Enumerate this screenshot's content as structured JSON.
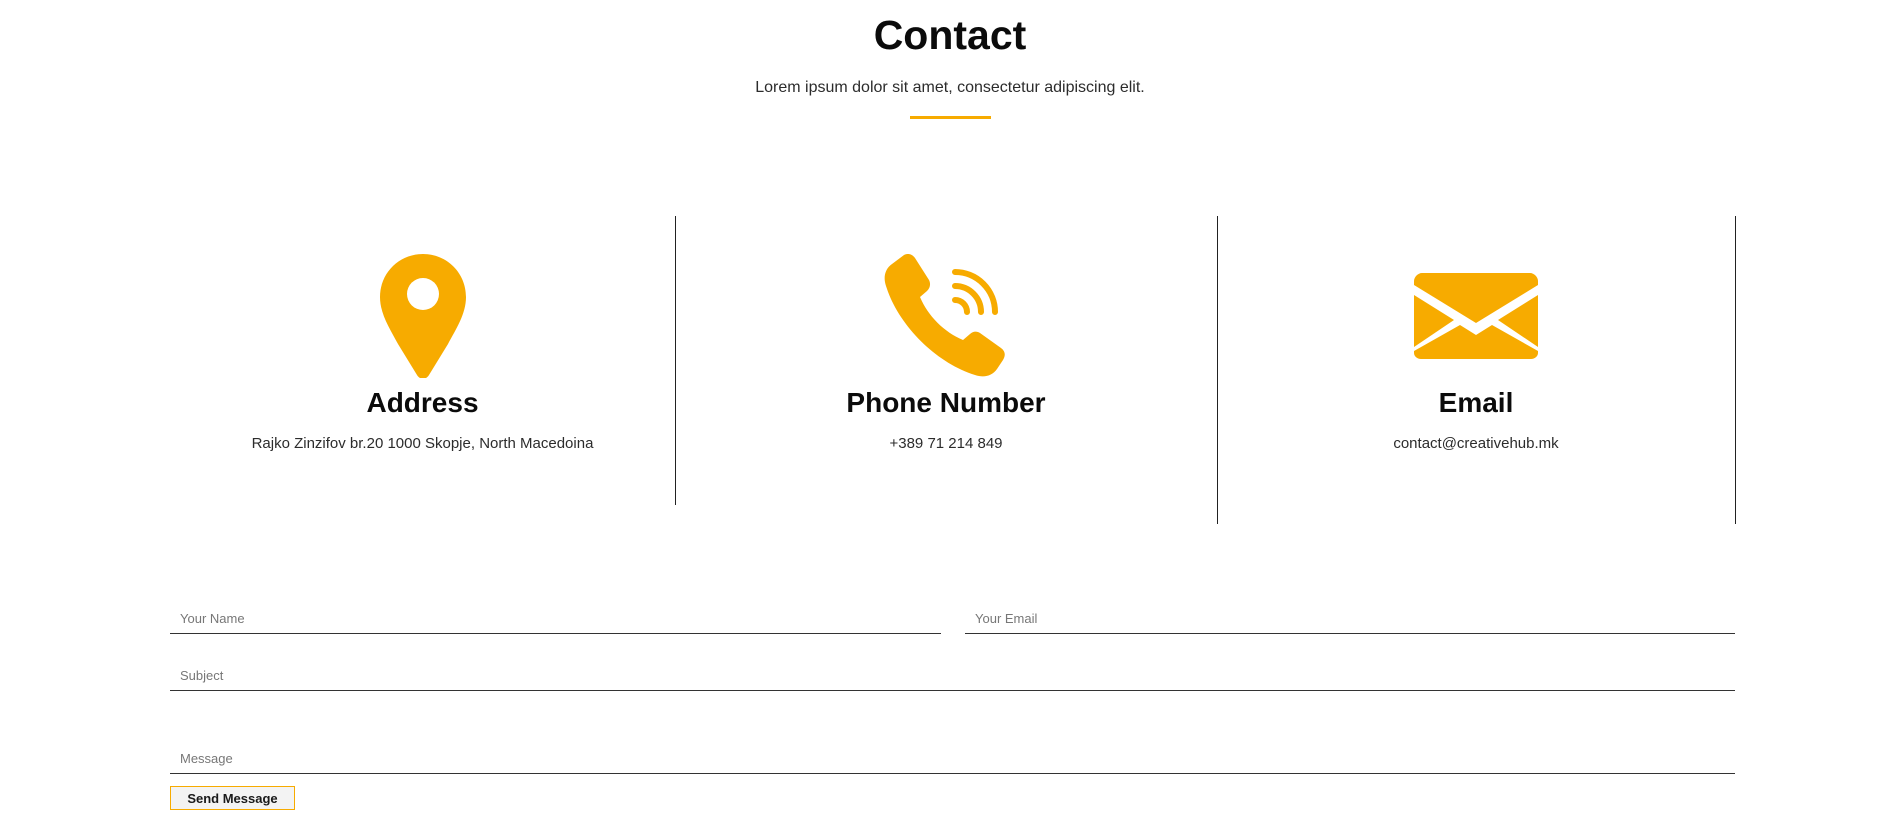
{
  "header": {
    "title": "Contact",
    "subtitle": "Lorem ipsum dolor sit amet, consectetur adipiscing elit."
  },
  "colors": {
    "accent": "#f7ab00",
    "text": "#0b0b0b",
    "divider": "#222222"
  },
  "info_cards": [
    {
      "icon": "map-pin-icon",
      "heading": "Address",
      "text": "Rajko Zinzifov br.20 1000 Skopje, North Macedoina"
    },
    {
      "icon": "phone-ringing-icon",
      "heading": "Phone Number",
      "text": "+389 71 214 849"
    },
    {
      "icon": "envelope-icon",
      "heading": "Email",
      "text": "contact@creativehub.mk"
    }
  ],
  "form": {
    "name": {
      "value": "",
      "placeholder": "Your Name"
    },
    "email": {
      "value": "",
      "placeholder": "Your Email"
    },
    "subject": {
      "value": "",
      "placeholder": "Subject"
    },
    "message": {
      "value": "",
      "placeholder": "Message"
    },
    "submit_label": "Send Message"
  }
}
